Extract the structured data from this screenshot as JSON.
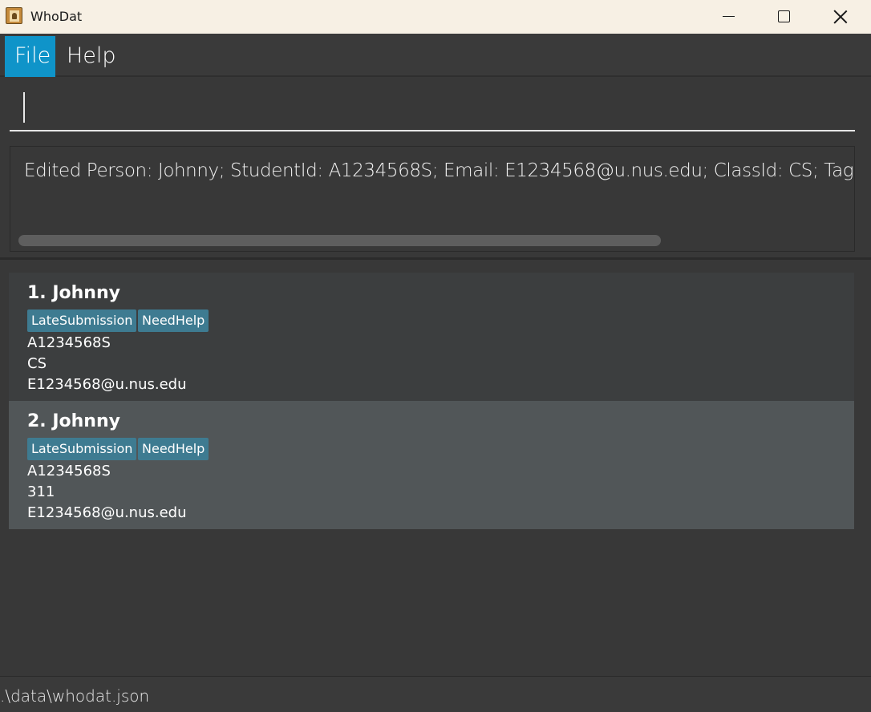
{
  "window": {
    "title": "WhoDat",
    "icon": "address-book-icon",
    "controls": [
      "minimize-icon",
      "maximize-icon",
      "close-icon"
    ]
  },
  "menu": {
    "file_label": "File",
    "help_label": "Help",
    "active": "File",
    "active_color": "#0f94c9"
  },
  "command": {
    "value": "",
    "placeholder": ""
  },
  "result": {
    "text": "Edited Person: Johnny; StudentId: A1234568S; Email: E1234568@u.nus.edu; ClassId: CS; Tags: [NeedHelp][LateSubmission]"
  },
  "persons": [
    {
      "index_name": "1. Johnny",
      "tags": [
        "LateSubmission",
        "NeedHelp"
      ],
      "student_id": "A1234568S",
      "class_id": "CS",
      "email": "E1234568@u.nus.edu",
      "selected": false
    },
    {
      "index_name": "2. Johnny",
      "tags": [
        "LateSubmission",
        "NeedHelp"
      ],
      "student_id": "A1234568S",
      "class_id": "311",
      "email": "E1234568@u.nus.edu",
      "selected": true
    }
  ],
  "status": {
    "path": ".\\data\\whodat.json"
  },
  "colors": {
    "background": "#383838",
    "tag": "#3e7b91",
    "selected_card": "#515658"
  }
}
